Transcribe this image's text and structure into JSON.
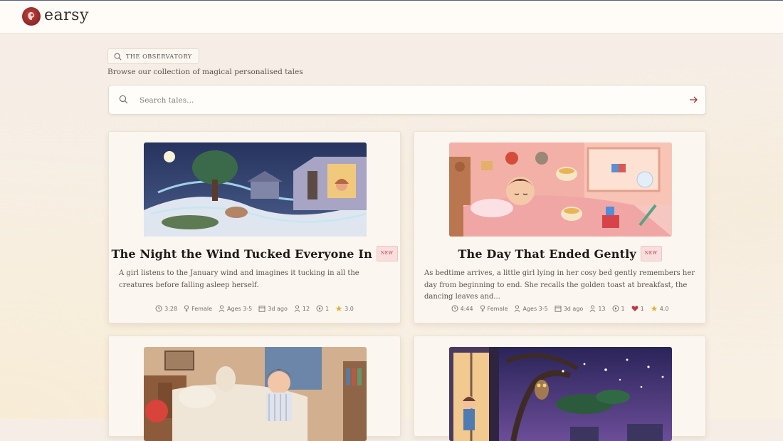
{
  "app": {
    "name": "earsy"
  },
  "section": {
    "label": "THE OBSERVATORY",
    "subtitle": "Browse our collection of magical personalised tales"
  },
  "search": {
    "placeholder": "Search tales..."
  },
  "cards": [
    {
      "title": "The Night the Wind Tucked Everyone In",
      "badge": "NEW",
      "description": "A girl listens to the January wind and imagines it tucking in all the creatures before falling asleep herself.",
      "duration": "3:28",
      "gender": "Female",
      "ages": "Ages 3-5",
      "age": "3d ago",
      "listeners": "12",
      "plays": "1",
      "likes": null,
      "rating": "3.0"
    },
    {
      "title": "The Day That Ended Gently",
      "badge": "NEW",
      "description": "As bedtime arrives, a little girl lying in her cosy bed gently remembers her day from beginning to end. She recalls the golden toast at breakfast, the dancing leaves and...",
      "duration": "4:44",
      "gender": "Female",
      "ages": "Ages 3-5",
      "age": "3d ago",
      "listeners": "13",
      "plays": "1",
      "likes": "1",
      "rating": "4.0"
    },
    {
      "title": "",
      "badge": "",
      "description": ""
    },
    {
      "title": "",
      "badge": "",
      "description": ""
    }
  ],
  "colors": {
    "accent": "#8e2727",
    "badge_text": "#b2344a",
    "star": "#e2b23c",
    "heart": "#c23a4a"
  }
}
